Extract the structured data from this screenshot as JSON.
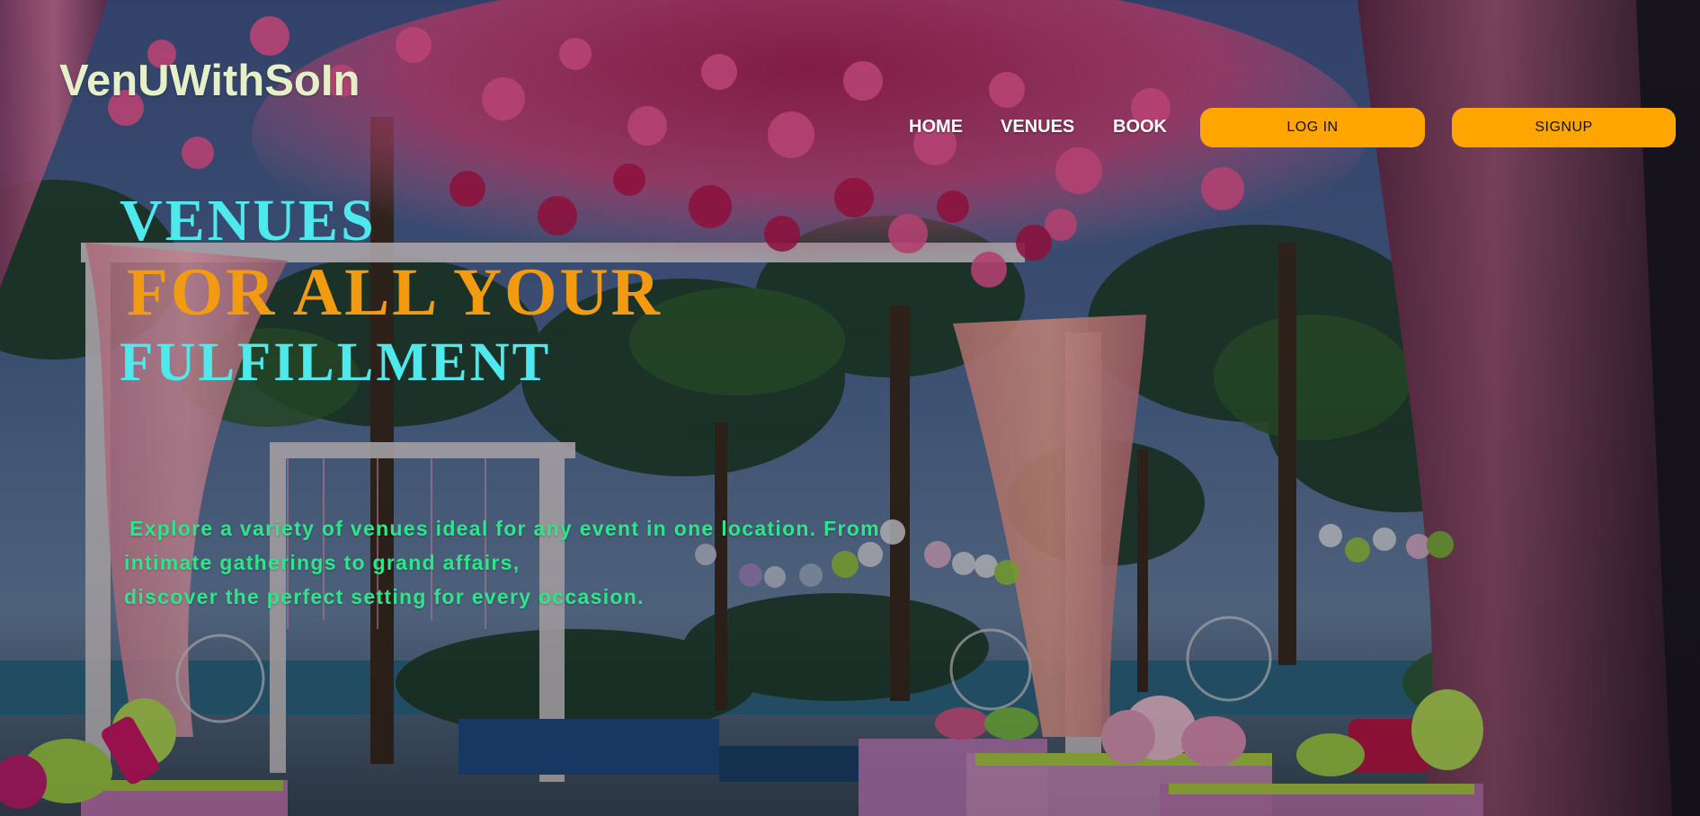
{
  "brand": {
    "logo_text": "VenUWithSoIn"
  },
  "nav": {
    "links": [
      "HOME",
      "VENUES",
      "BOOK"
    ],
    "login_label": "LOG IN",
    "signup_label": "SIGNUP"
  },
  "hero": {
    "headline_line1": "VENUES",
    "headline_line2": "FOR ALL YOUR",
    "headline_line3": "FULFILLMENT",
    "description_lines": [
      "Explore a variety of venues ideal for any event in one location. From",
      "intimate gatherings to grand affairs,",
      "discover the perfect setting for every occasion."
    ]
  },
  "colors": {
    "accent": "#ffa500",
    "headline_cyan": "#4ee9ec",
    "headline_orange": "#f29b10",
    "description_green": "#2ee68a",
    "logo": "#e6f0c8"
  }
}
